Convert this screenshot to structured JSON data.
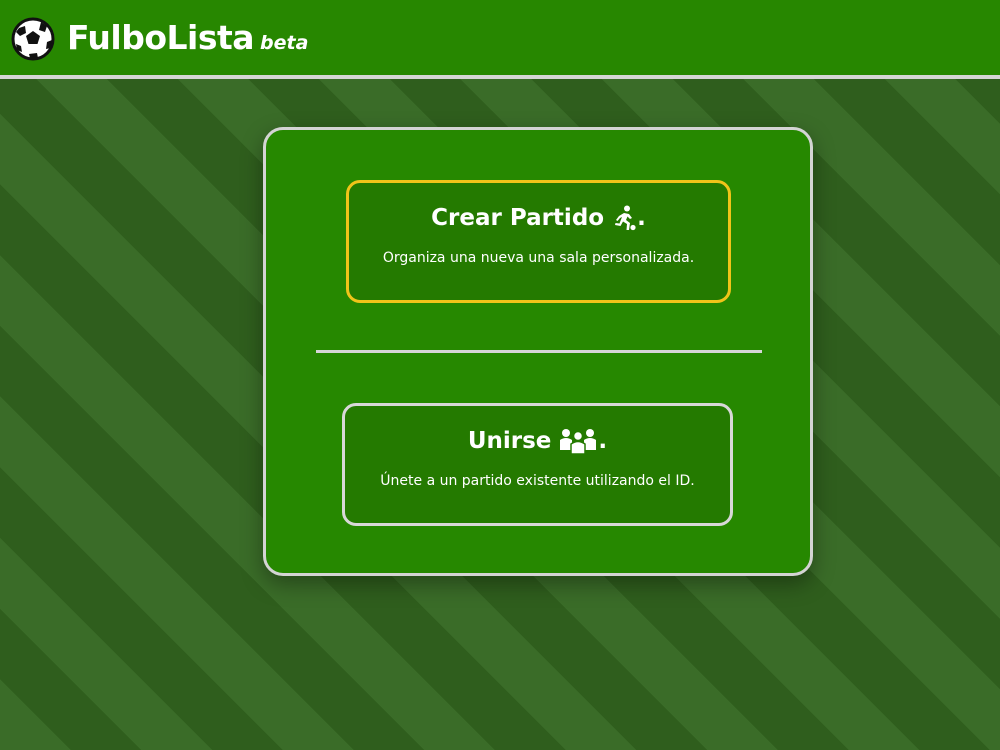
{
  "header": {
    "brand_name": "FulboLista",
    "brand_tag": "beta",
    "logo_icon": "soccer-ball-icon",
    "bg_color": "#278700"
  },
  "options": {
    "create": {
      "title": "Crear Partido",
      "suffix": ".",
      "icon": "running-player-icon",
      "description": "Organiza una nueva una sala personalizada.",
      "border_color": "#f0c419"
    },
    "join": {
      "title": "Unirse",
      "suffix": ".",
      "icon": "group-people-icon",
      "description": "Únete a un partido existente utilizando el ID.",
      "border_color": "#d8d8d8"
    }
  }
}
